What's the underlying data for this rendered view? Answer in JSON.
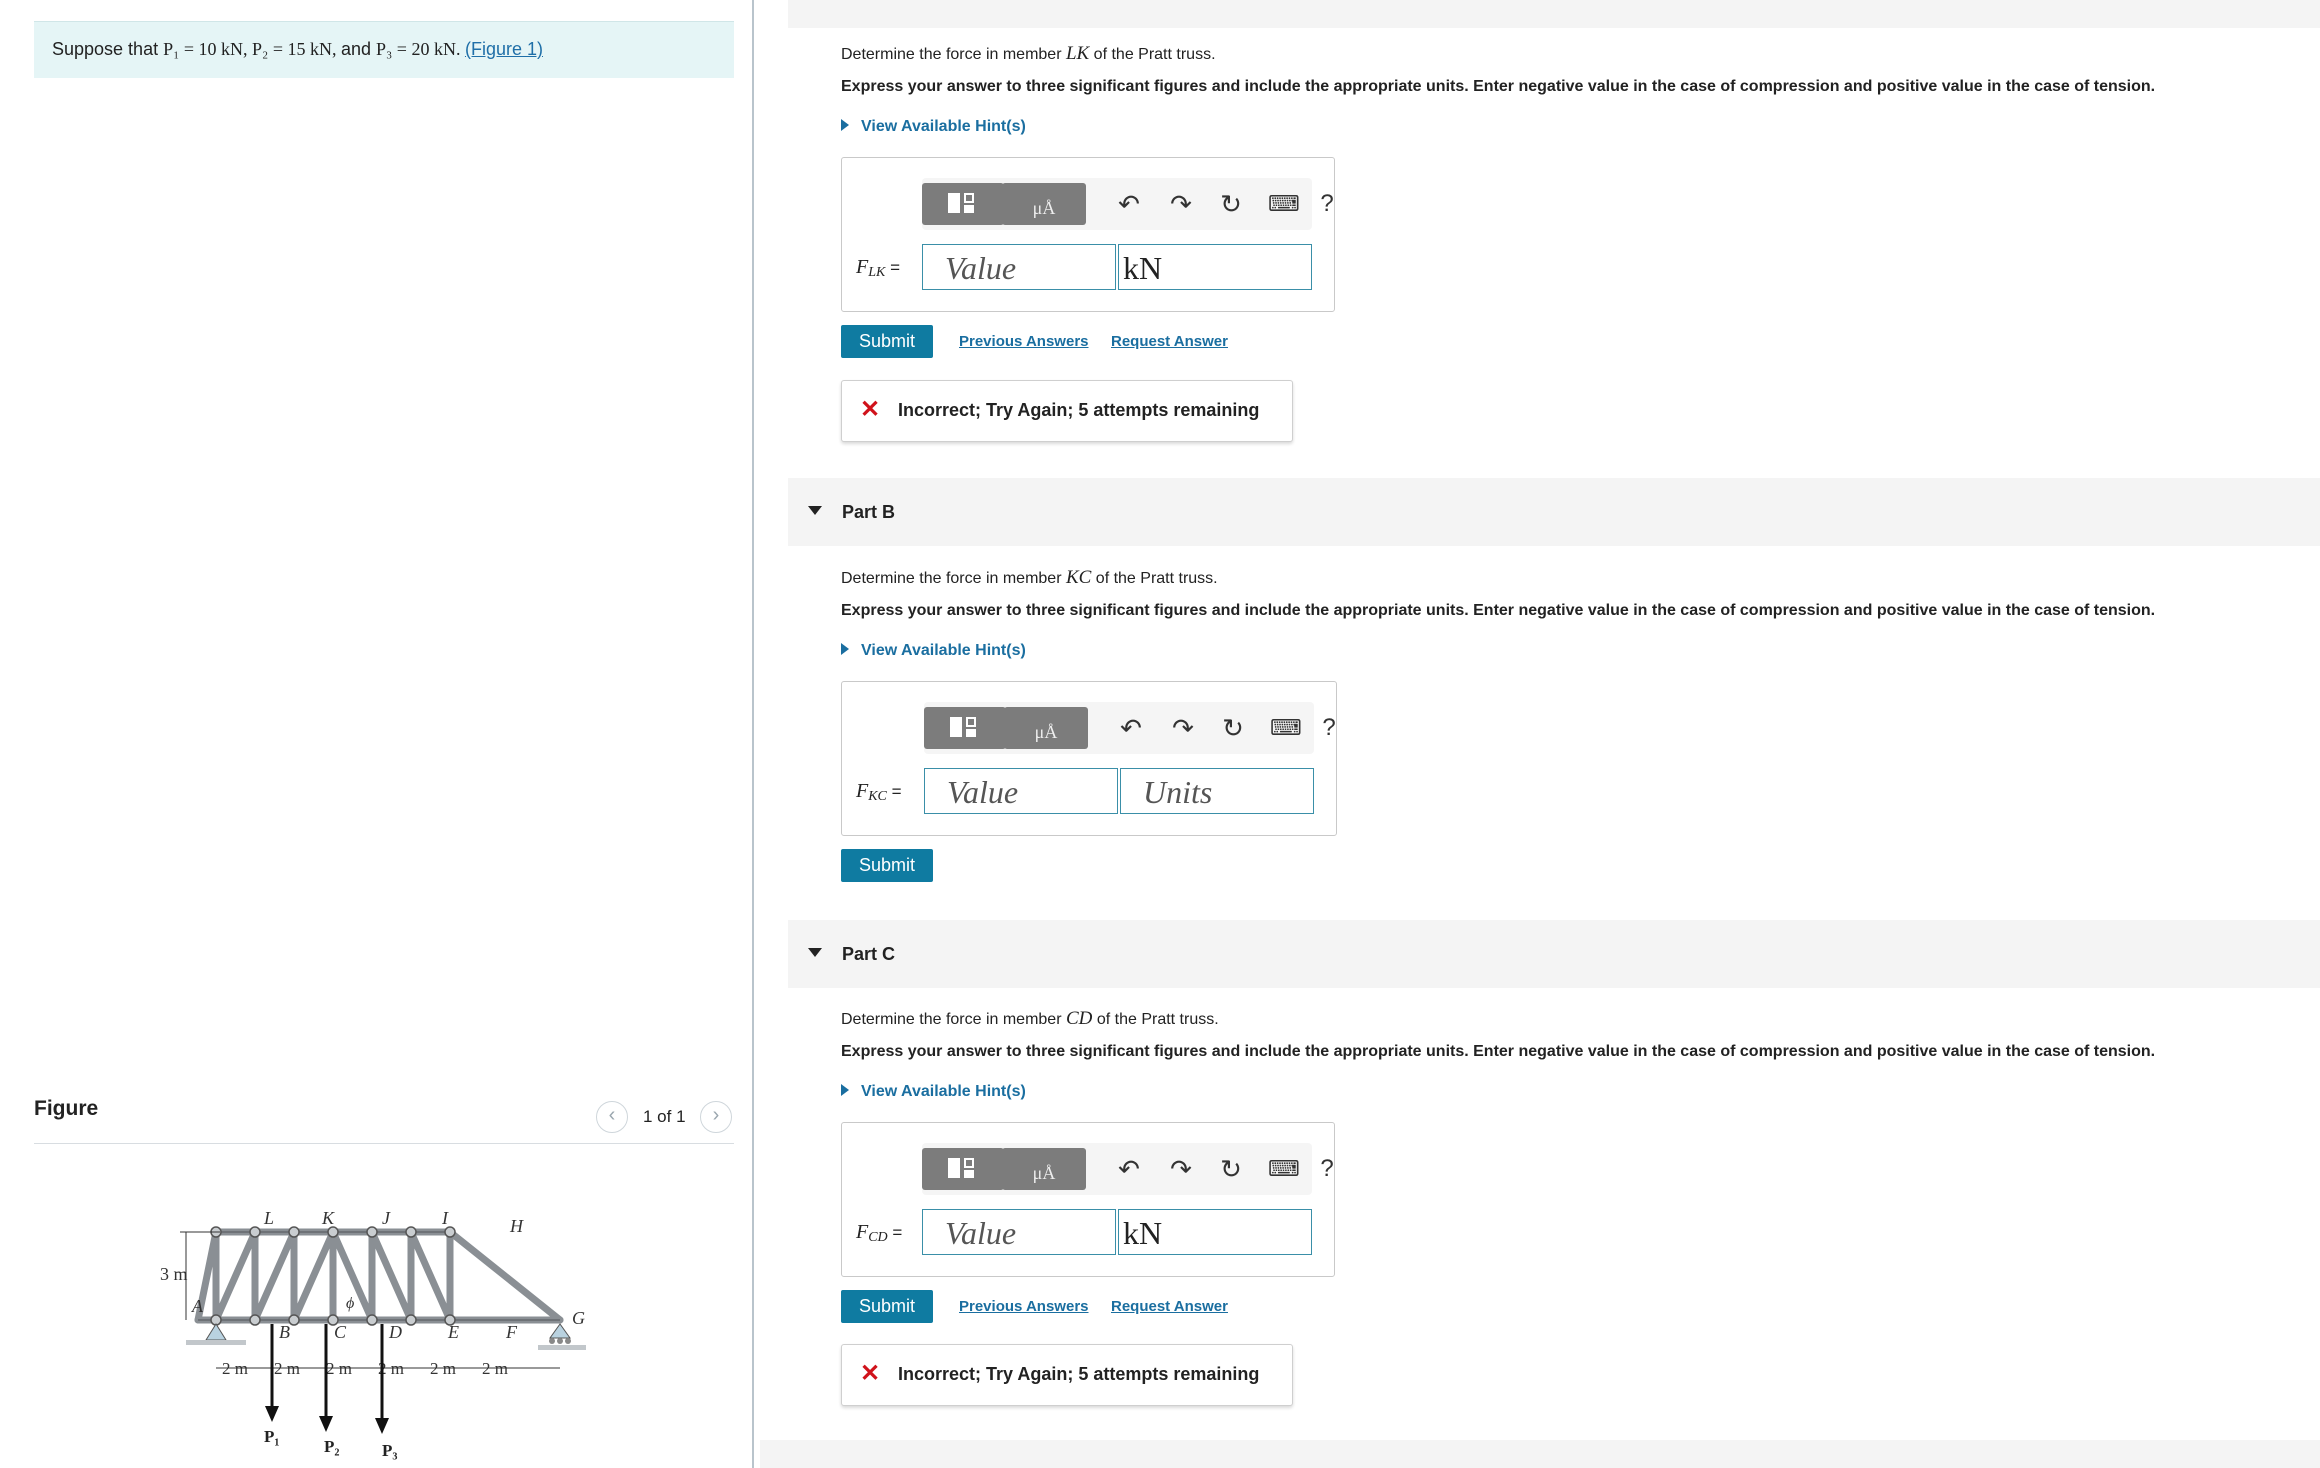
{
  "problem": {
    "prefix": "Suppose that ",
    "p1": "P₁ = 10 kN, ",
    "p2": "P₂ = 15 kN, ",
    "and": "and ",
    "p3": "P₃ = 20 kN. ",
    "figure_link": "(Figure 1)"
  },
  "figure": {
    "label": "Figure",
    "pager": "1 of 1",
    "prev_icon": "‹",
    "next_icon": "›",
    "truss": {
      "top_nodes": [
        "L",
        "K",
        "J",
        "I",
        "H"
      ],
      "bottom_nodes": [
        "A",
        "B",
        "C",
        "D",
        "E",
        "F",
        "G"
      ],
      "height_label": "3 m",
      "angle_label": "ϕ",
      "spans": [
        "2 m",
        "2 m",
        "2 m",
        "2 m",
        "2 m",
        "2 m"
      ],
      "loads": [
        "P₁",
        "P₂",
        "P₃"
      ]
    }
  },
  "toolbar": {
    "units_label": "μÅ",
    "undo_icon": "↶",
    "redo_icon": "↷",
    "reset_icon": "↻",
    "keyboard_icon": "⌨",
    "help_label": "?"
  },
  "part_a": {
    "question_prefix": "Determine the force in member ",
    "member": "LK",
    "question_suffix": " of the Pratt truss.",
    "instructions": "Express your answer to three significant figures and include the appropriate units. Enter negative value in the case of compression and positive value in the case of tension.",
    "hint": "View Available Hint(s)",
    "var_main": "F",
    "var_sub": "LK",
    "eq": " =",
    "value_placeholder": "Value",
    "unit_value": "kN",
    "submit": "Submit",
    "previous_answers": "Previous Answers",
    "request_answer": "Request Answer",
    "feedback": "Incorrect; Try Again; 5 attempts remaining",
    "feedback_icon": "✕"
  },
  "part_b": {
    "title": "Part B",
    "question_prefix": "Determine the force in member ",
    "member": "KC",
    "question_suffix": " of the Pratt truss.",
    "instructions": "Express your answer to three significant figures and include the appropriate units. Enter negative value in the case of compression and positive value in the case of tension.",
    "hint": "View Available Hint(s)",
    "var_main": "F",
    "var_sub": "KC",
    "eq": " =",
    "value_placeholder": "Value",
    "unit_placeholder": "Units",
    "submit": "Submit"
  },
  "part_c": {
    "title": "Part C",
    "question_prefix": "Determine the force in member ",
    "member": "CD",
    "question_suffix": " of the Pratt truss.",
    "instructions": "Express your answer to three significant figures and include the appropriate units. Enter negative value in the case of compression and positive value in the case of tension.",
    "hint": "View Available Hint(s)",
    "var_main": "F",
    "var_sub": "CD",
    "eq": " =",
    "value_placeholder": "Value",
    "unit_value": "kN",
    "submit": "Submit",
    "previous_answers": "Previous Answers",
    "request_answer": "Request Answer",
    "feedback": "Incorrect; Try Again; 5 attempts remaining",
    "feedback_icon": "✕"
  },
  "colors": {
    "accent": "#0f7ba1",
    "link": "#1a6ea0",
    "error": "#d0121b",
    "problem_bg": "#e5f5f6"
  }
}
